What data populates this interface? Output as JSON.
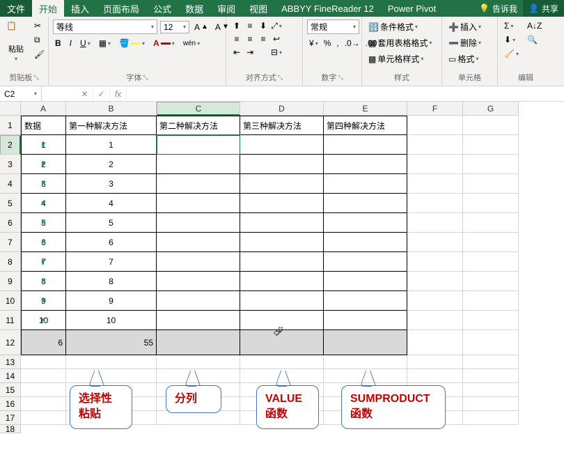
{
  "tabs": {
    "file": "文件",
    "home": "开始",
    "insert": "插入",
    "layout": "页面布局",
    "formulas": "公式",
    "data": "数据",
    "review": "审阅",
    "view": "视图",
    "abbyy": "ABBYY FineReader 12",
    "powerpivot": "Power Pivot",
    "tellme": "告诉我",
    "share": "共享"
  },
  "ribbon": {
    "clipboard": {
      "paste": "粘贴",
      "label": "剪贴板"
    },
    "font": {
      "name": "等线",
      "size": "12",
      "label": "字体"
    },
    "align": {
      "label": "对齐方式"
    },
    "number": {
      "format": "常规",
      "label": "数字"
    },
    "styles": {
      "condfmt": "条件格式",
      "tblfmt": "套用表格格式",
      "cellstyle": "单元格样式",
      "label": "样式"
    },
    "cells": {
      "insert": "插入",
      "delete": "删除",
      "format": "格式",
      "label": "单元格"
    },
    "editing": {
      "label": "编辑"
    }
  },
  "formula_bar": {
    "cell_ref": "C2",
    "value": ""
  },
  "grid": {
    "cols": [
      "A",
      "B",
      "C",
      "D",
      "E",
      "F",
      "G"
    ],
    "headers": {
      "A": "数据",
      "B": "第一种解决方法",
      "C": "第二种解决方法",
      "D": "第三种解决方法",
      "E": "第四种解决方法"
    },
    "rows": [
      {
        "r": 1,
        "A": "数据",
        "B": "第一种解决方法",
        "C": "第二种解决方法",
        "D": "第三种解决方法",
        "E": "第四种解决方法"
      },
      {
        "r": 2,
        "A": "1",
        "B": "1"
      },
      {
        "r": 3,
        "A": "2",
        "B": "2"
      },
      {
        "r": 4,
        "A": "3",
        "B": "3"
      },
      {
        "r": 5,
        "A": "4",
        "B": "4"
      },
      {
        "r": 6,
        "A": "5",
        "B": "5"
      },
      {
        "r": 7,
        "A": "6",
        "B": "6"
      },
      {
        "r": 8,
        "A": "7",
        "B": "7"
      },
      {
        "r": 9,
        "A": "8",
        "B": "8"
      },
      {
        "r": 10,
        "A": "9",
        "B": "9"
      },
      {
        "r": 11,
        "A": "10",
        "B": "10"
      },
      {
        "r": 12,
        "A": "6",
        "B": "55"
      }
    ],
    "selected_cell": "C2"
  },
  "callouts": {
    "c1": "选择性\n粘贴",
    "c2": "分列",
    "c3": "VALUE\n函数",
    "c4": "SUMPRODUCT\n函数"
  }
}
